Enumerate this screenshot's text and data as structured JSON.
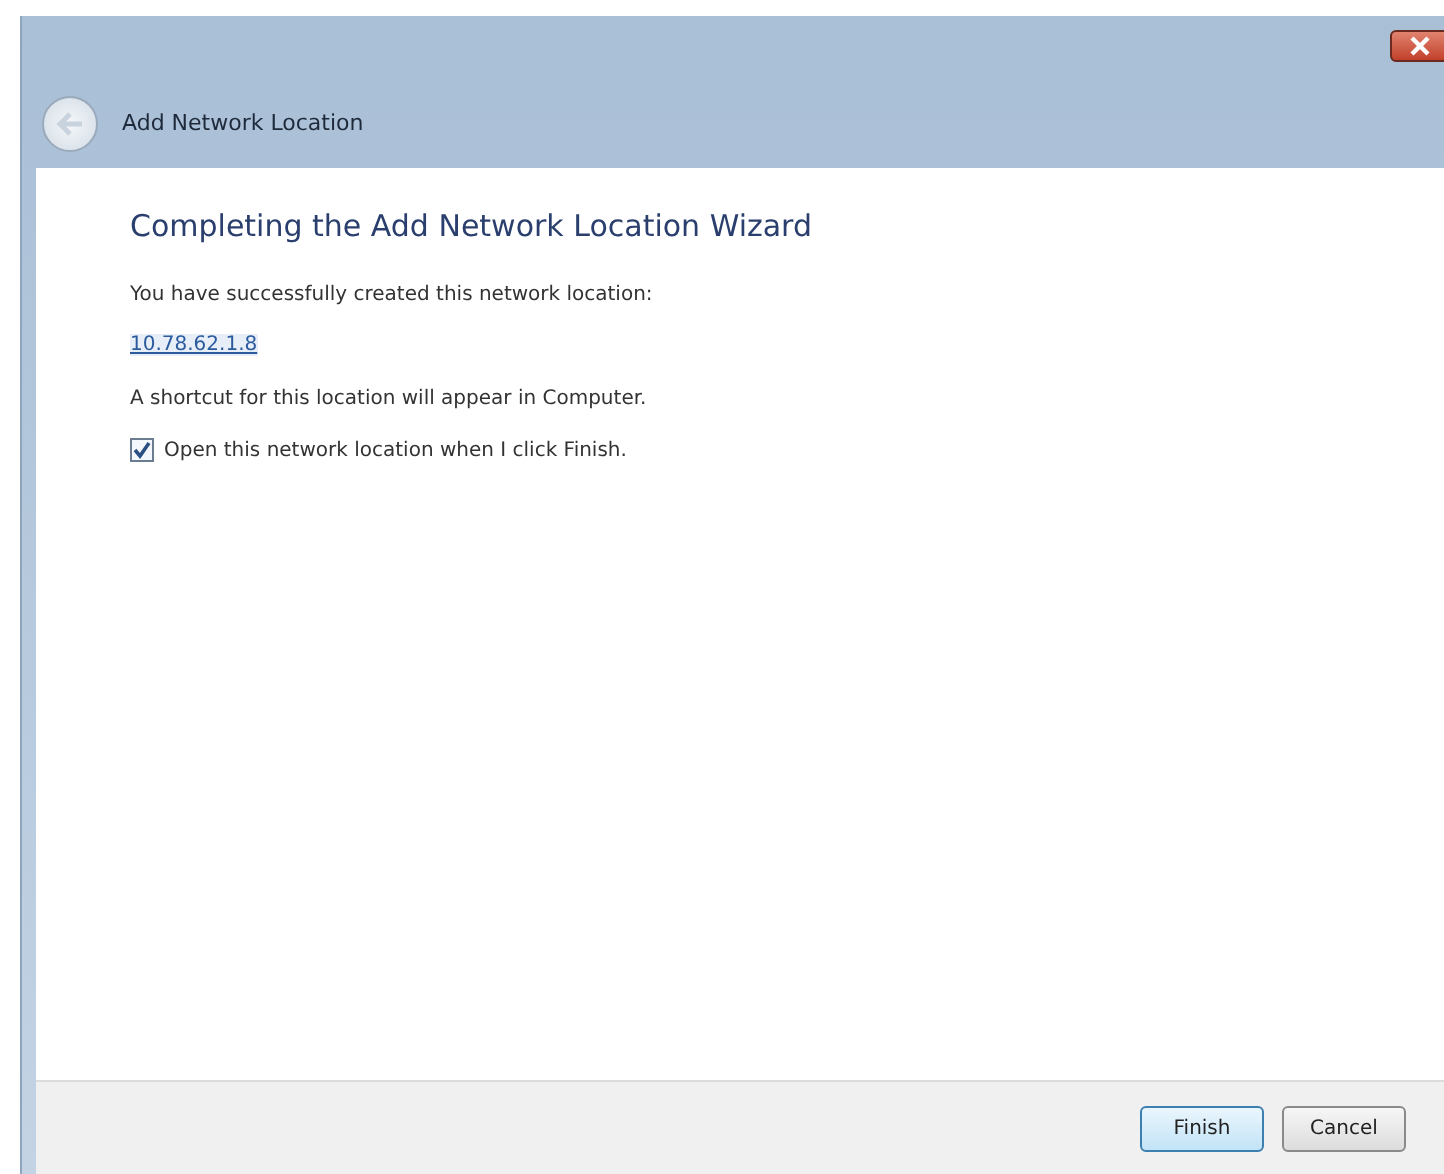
{
  "window": {
    "title": "Add Network Location"
  },
  "heading": "Completing the Add Network Location Wizard",
  "message": "You have successfully created this network location:",
  "location_link": "10.78.62.1.8",
  "shortcut_note": "A shortcut for this location will appear in Computer.",
  "open_option": {
    "label": "Open this network location when I click Finish.",
    "checked": true
  },
  "buttons": [
    {
      "label": "Finish",
      "default": true
    },
    {
      "label": "Cancel",
      "default": false
    }
  ]
}
